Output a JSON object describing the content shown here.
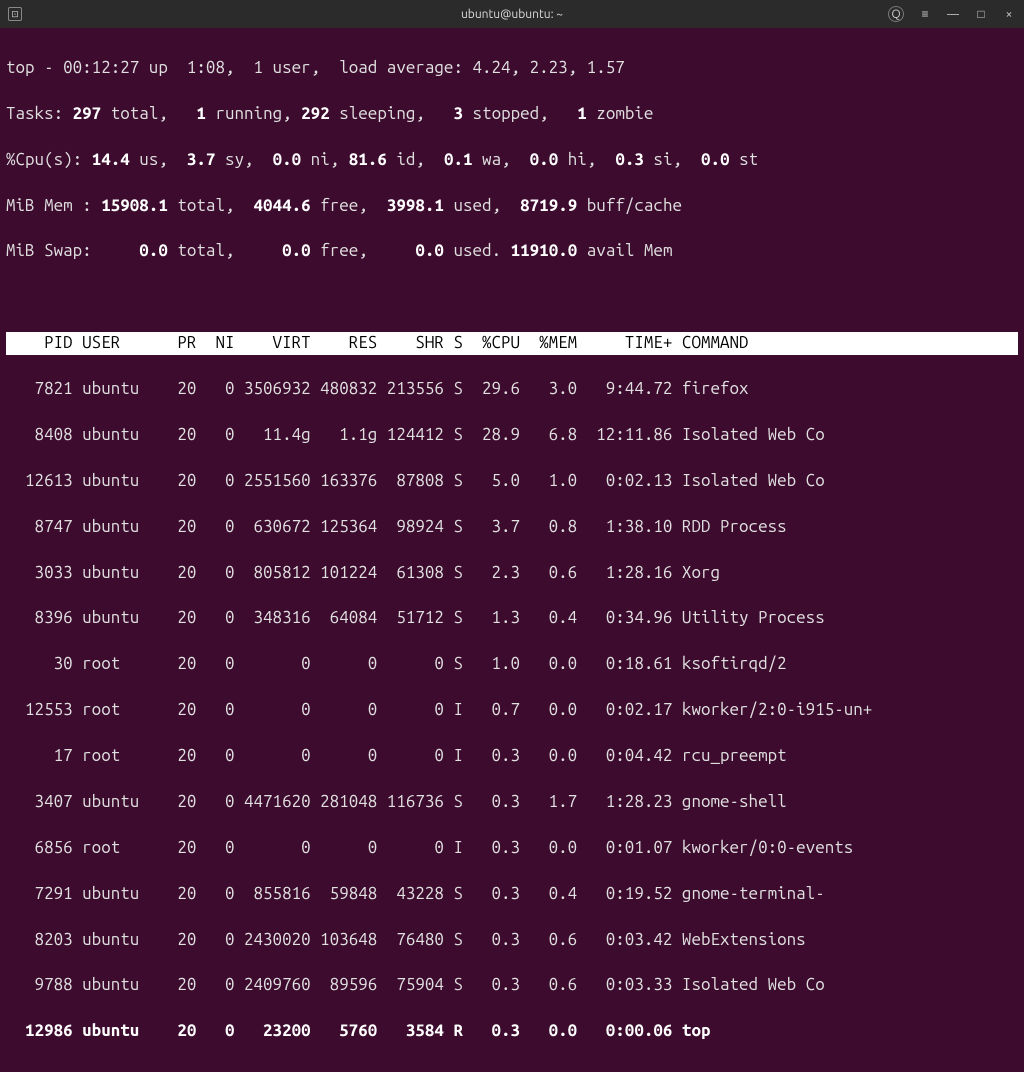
{
  "window": {
    "title": "ubuntu@ubuntu: ~"
  },
  "summary": {
    "line1_prefix": "top - 00:12:27 up  1:08,  1 user,  load average: 4.24, 2.23, 1.57",
    "tasks_label": "Tasks:",
    "tasks_total": " 297 ",
    "tasks_total_lbl": "total,",
    "tasks_run": "   1 ",
    "tasks_run_lbl": "running,",
    "tasks_sleep": " 292 ",
    "tasks_sleep_lbl": "sleeping,",
    "tasks_stop": "   3 ",
    "tasks_stop_lbl": "stopped,",
    "tasks_zombie": "   1 ",
    "tasks_zombie_lbl": "zombie",
    "cpu_label": "%Cpu(s):",
    "cpu_us": " 14.4 ",
    "cpu_us_lbl": "us,",
    "cpu_sy": "  3.7 ",
    "cpu_sy_lbl": "sy,",
    "cpu_ni": "  0.0 ",
    "cpu_ni_lbl": "ni,",
    "cpu_id": " 81.6 ",
    "cpu_id_lbl": "id,",
    "cpu_wa": "  0.1 ",
    "cpu_wa_lbl": "wa,",
    "cpu_hi": "  0.0 ",
    "cpu_hi_lbl": "hi,",
    "cpu_si": "  0.3 ",
    "cpu_si_lbl": "si,",
    "cpu_st": "  0.0 ",
    "cpu_st_lbl": "st",
    "mem_label": "MiB Mem :",
    "mem_total": " 15908.1 ",
    "mem_total_lbl": "total,",
    "mem_free": "  4044.6 ",
    "mem_free_lbl": "free,",
    "mem_used": "  3998.1 ",
    "mem_used_lbl": "used,",
    "mem_buff": "  8719.9 ",
    "mem_buff_lbl": "buff/cache",
    "swap_label": "MiB Swap:",
    "swap_total": "     0.0 ",
    "swap_total_lbl": "total,",
    "swap_free": "     0.0 ",
    "swap_free_lbl": "free,",
    "swap_used": "     0.0 ",
    "swap_used_lbl": "used.",
    "swap_avail": " 11910.0 ",
    "swap_avail_lbl": "avail Mem"
  },
  "header": "    PID USER      PR  NI    VIRT    RES    SHR S  %CPU  %MEM     TIME+ COMMAND             ",
  "rows": [
    "   7821 ubuntu    20   0 3506932 480832 213556 S  29.6   3.0   9:44.72 firefox",
    "   8408 ubuntu    20   0   11.4g   1.1g 124412 S  28.9   6.8  12:11.86 Isolated Web Co",
    "  12613 ubuntu    20   0 2551560 163376  87808 S   5.0   1.0   0:02.13 Isolated Web Co",
    "   8747 ubuntu    20   0  630672 125364  98924 S   3.7   0.8   1:38.10 RDD Process",
    "   3033 ubuntu    20   0  805812 101224  61308 S   2.3   0.6   1:28.16 Xorg",
    "   8396 ubuntu    20   0  348316  64084  51712 S   1.3   0.4   0:34.96 Utility Process",
    "     30 root      20   0       0      0      0 S   1.0   0.0   0:18.61 ksoftirqd/2",
    "  12553 root      20   0       0      0      0 I   0.7   0.0   0:02.17 kworker/2:0-i915-un+",
    "     17 root      20   0       0      0      0 I   0.3   0.0   0:04.42 rcu_preempt",
    "   3407 ubuntu    20   0 4471620 281048 116736 S   0.3   1.7   1:28.23 gnome-shell",
    "   6856 root      20   0       0      0      0 I   0.3   0.0   0:01.07 kworker/0:0-events",
    "   7291 ubuntu    20   0  855816  59848  43228 S   0.3   0.4   0:19.52 gnome-terminal-",
    "   8203 ubuntu    20   0 2430020 103648  76480 S   0.3   0.6   0:03.42 WebExtensions",
    "   9788 ubuntu    20   0 2409760  89596  75904 S   0.3   0.6   0:03.33 Isolated Web Co"
  ],
  "current_row": "  12986 ubuntu    20   0   23200   5760   3584 R   0.3   0.0   0:00.06 top"
}
